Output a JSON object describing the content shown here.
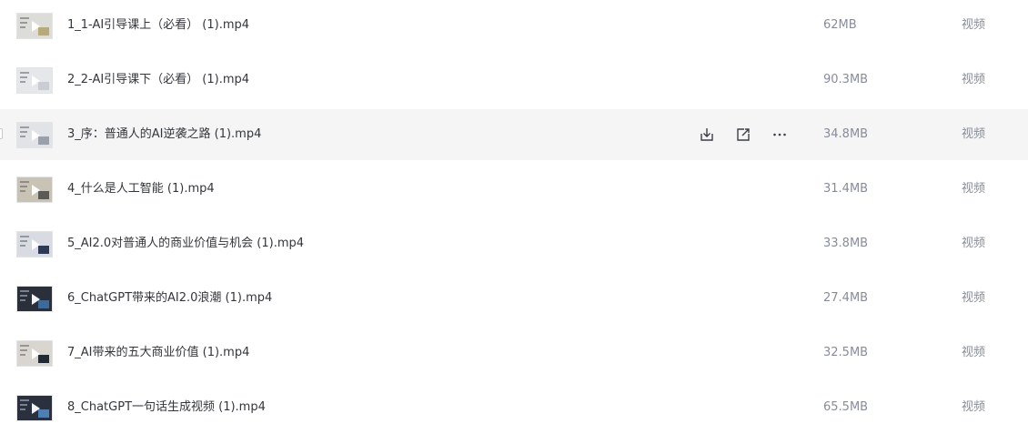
{
  "files": [
    {
      "name": "1_1-AI引导课上（必看） (1).mp4",
      "size": "62MB",
      "type": "视频",
      "thumb": {
        "bg": "#dcdcd8",
        "accent": "#b7a97a",
        "dark": false
      }
    },
    {
      "name": "2_2-AI引导课下（必看） (1).mp4",
      "size": "90.3MB",
      "type": "视频",
      "thumb": {
        "bg": "#e6e7ea",
        "accent": "#c9ccd3",
        "dark": false
      }
    },
    {
      "name": "3_序：普通人的AI逆袭之路 (1).mp4",
      "size": "34.8MB",
      "type": "视频",
      "thumb": {
        "bg": "#e2e3e6",
        "accent": "#9aa0ab",
        "dark": false
      }
    },
    {
      "name": "4_什么是人工智能 (1).mp4",
      "size": "31.4MB",
      "type": "视频",
      "thumb": {
        "bg": "#c9c3b6",
        "accent": "#5c5a55",
        "dark": false
      }
    },
    {
      "name": "5_AI2.0对普通人的商业价值与机会 (1).mp4",
      "size": "33.8MB",
      "type": "视频",
      "thumb": {
        "bg": "#d8dbe2",
        "accent": "#2d3a55",
        "dark": false
      }
    },
    {
      "name": "6_ChatGPT带来的AI2.0浪潮 (1).mp4",
      "size": "27.4MB",
      "type": "视频",
      "thumb": {
        "bg": "#2b2f3a",
        "accent": "#3e6a9a",
        "dark": true
      }
    },
    {
      "name": "7_AI带来的五大商业价值 (1).mp4",
      "size": "32.5MB",
      "type": "视频",
      "thumb": {
        "bg": "#d9d6cf",
        "accent": "#222a35",
        "dark": false
      }
    },
    {
      "name": "8_ChatGPT一句话生成视频 (1).mp4",
      "size": "65.5MB",
      "type": "视频",
      "thumb": {
        "bg": "#2a303d",
        "accent": "#4d7fb0",
        "dark": true
      }
    }
  ],
  "hovered_row": 2,
  "row_actions": [
    {
      "icon": "download-icon"
    },
    {
      "icon": "share-icon"
    },
    {
      "icon": "more-icon"
    }
  ]
}
